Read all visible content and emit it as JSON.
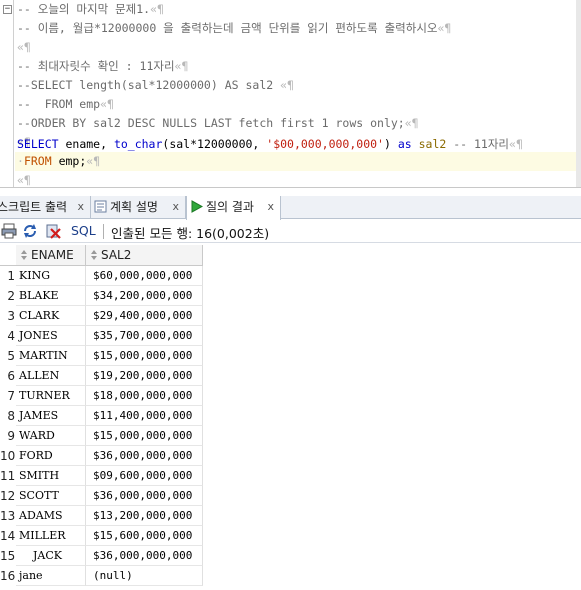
{
  "editor": {
    "line1": "-- 오늘의 마지막 문제1.",
    "line2": "-- 이름, 월급*12000000 을 출력하는데 금액 단위를 읽기 편하도록 출력하시오",
    "line3": "",
    "line4": "-- 최대자릿수 확인 : 11자리",
    "line5": "--SELECT length(sal*12000000) AS sal2 ",
    "line6": "--  FROM emp",
    "line7": "--ORDER BY sal2 DESC NULLS LAST fetch first 1 rows only;",
    "line8": "",
    "line9": {
      "kw_select": "SELECT",
      "ename": " ename, ",
      "fn": "to_char",
      "args1": "(sal*12000000, ",
      "fmt": "'$00,000,000,000'",
      "args2": ") ",
      "kw_as": "as",
      "alias": " sal2 ",
      "comment": "-- 11자리"
    },
    "line10": {
      "kw_from": "FROM",
      "rest": " emp;"
    },
    "line11": ""
  },
  "tabs": [
    {
      "label": "스크립트 출력",
      "close": "x"
    },
    {
      "label": "계획 설명",
      "close": "x"
    },
    {
      "label": "질의 결과",
      "close": "x"
    }
  ],
  "toolbar": {
    "sql_label": "SQL",
    "status": "인출된 모든 행: 16(0,002초)"
  },
  "grid": {
    "columns": [
      "ENAME",
      "SAL2"
    ],
    "rows": [
      {
        "n": "1",
        "ename": "KING",
        "sal2": "$60,000,000,000"
      },
      {
        "n": "2",
        "ename": "BLAKE",
        "sal2": "$34,200,000,000"
      },
      {
        "n": "3",
        "ename": "CLARK",
        "sal2": "$29,400,000,000"
      },
      {
        "n": "4",
        "ename": "JONES",
        "sal2": "$35,700,000,000"
      },
      {
        "n": "5",
        "ename": "MARTIN",
        "sal2": "$15,000,000,000"
      },
      {
        "n": "6",
        "ename": "ALLEN",
        "sal2": "$19,200,000,000"
      },
      {
        "n": "7",
        "ename": "TURNER",
        "sal2": "$18,000,000,000"
      },
      {
        "n": "8",
        "ename": "JAMES",
        "sal2": "$11,400,000,000"
      },
      {
        "n": "9",
        "ename": "WARD",
        "sal2": "$15,000,000,000"
      },
      {
        "n": "10",
        "ename": "FORD",
        "sal2": "$36,000,000,000"
      },
      {
        "n": "11",
        "ename": "SMITH",
        "sal2": "$09,600,000,000"
      },
      {
        "n": "12",
        "ename": "SCOTT",
        "sal2": "$36,000,000,000"
      },
      {
        "n": "13",
        "ename": "ADAMS",
        "sal2": "$13,200,000,000"
      },
      {
        "n": "14",
        "ename": "MILLER",
        "sal2": "$15,600,000,000"
      },
      {
        "n": "15",
        "ename": "    JACK",
        "sal2": "$36,000,000,000"
      },
      {
        "n": "16",
        "ename": "jane",
        "sal2": "(null)"
      }
    ]
  }
}
